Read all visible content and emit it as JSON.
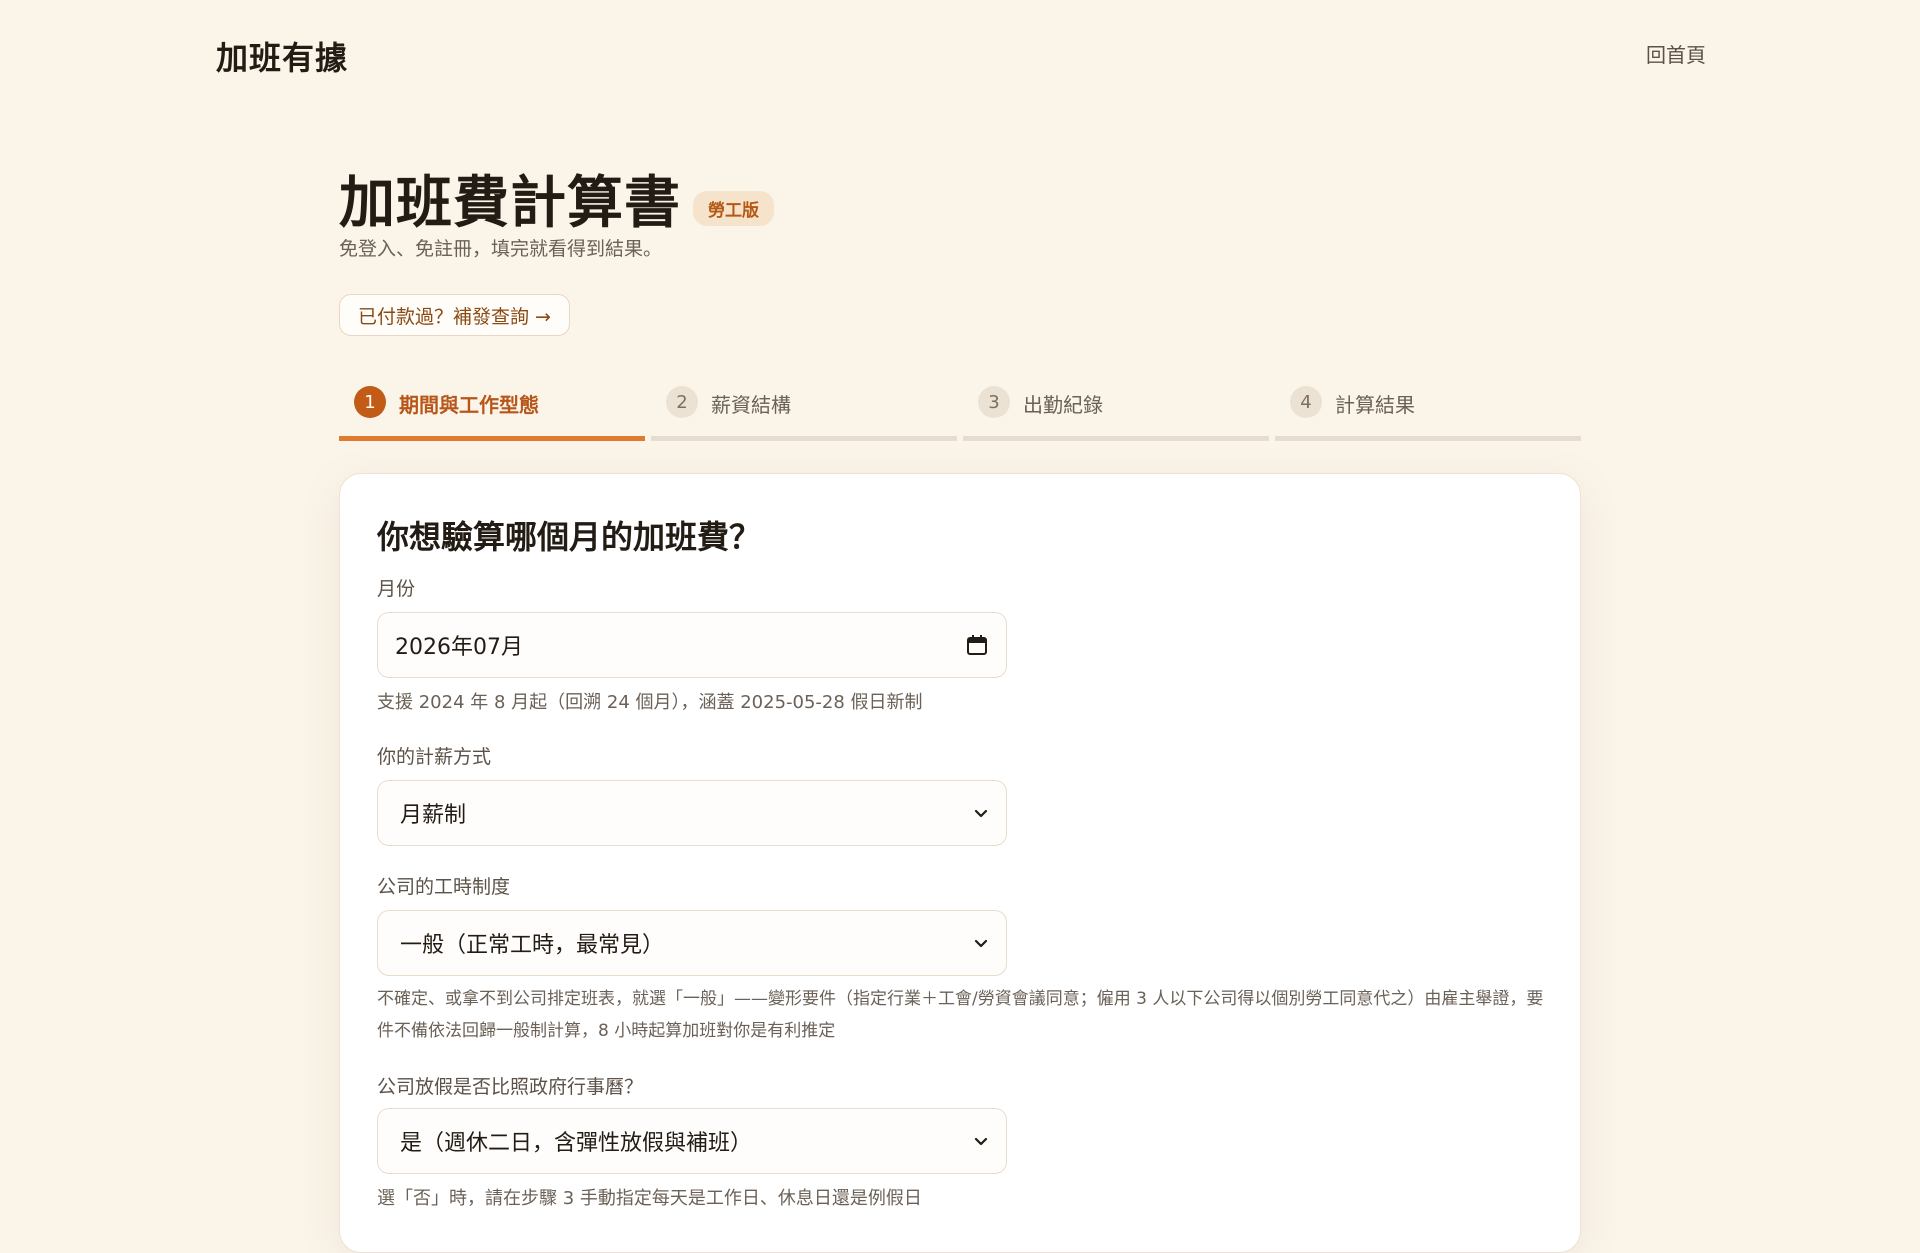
{
  "brand": {
    "logo": "加班有據"
  },
  "nav": {
    "home": "回首頁"
  },
  "header": {
    "title": "加班費計算書",
    "badge": "勞工版",
    "subtitle": "免登入、免註冊，填完就看得到結果。",
    "reissue_button": "已付款過？補發查詢 →"
  },
  "steps": [
    {
      "num": "1",
      "label": "期間與工作型態",
      "active": true
    },
    {
      "num": "2",
      "label": "薪資結構",
      "active": false
    },
    {
      "num": "3",
      "label": "出勤紀錄",
      "active": false
    },
    {
      "num": "4",
      "label": "計算結果",
      "active": false
    }
  ],
  "form": {
    "title": "你想驗算哪個月的加班費？",
    "month": {
      "label": "月份",
      "value": "2026年07月",
      "hint": "支援 2024 年 8 月起（回溯 24 個月），涵蓋 2025-05-28 假日新制"
    },
    "pay_type": {
      "label": "你的計薪方式",
      "value": "月薪制"
    },
    "hours_system": {
      "label": "公司的工時制度",
      "value": "一般（正常工時，最常見）",
      "hint": "不確定、或拿不到公司排定班表，就選「一般」——變形要件（指定行業＋工會/勞資會議同意；僱用 3 人以下公司得以個別勞工同意代之）由雇主舉證，要件不備依法回歸一般制計算，8 小時起算加班對你是有利推定"
    },
    "holiday_calendar": {
      "label": "公司放假是否比照政府行事曆？",
      "value": "是（週休二日，含彈性放假與補班）",
      "hint": "選「否」時，請在步驟 3 手動指定每天是工作日、休息日還是例假日"
    }
  }
}
